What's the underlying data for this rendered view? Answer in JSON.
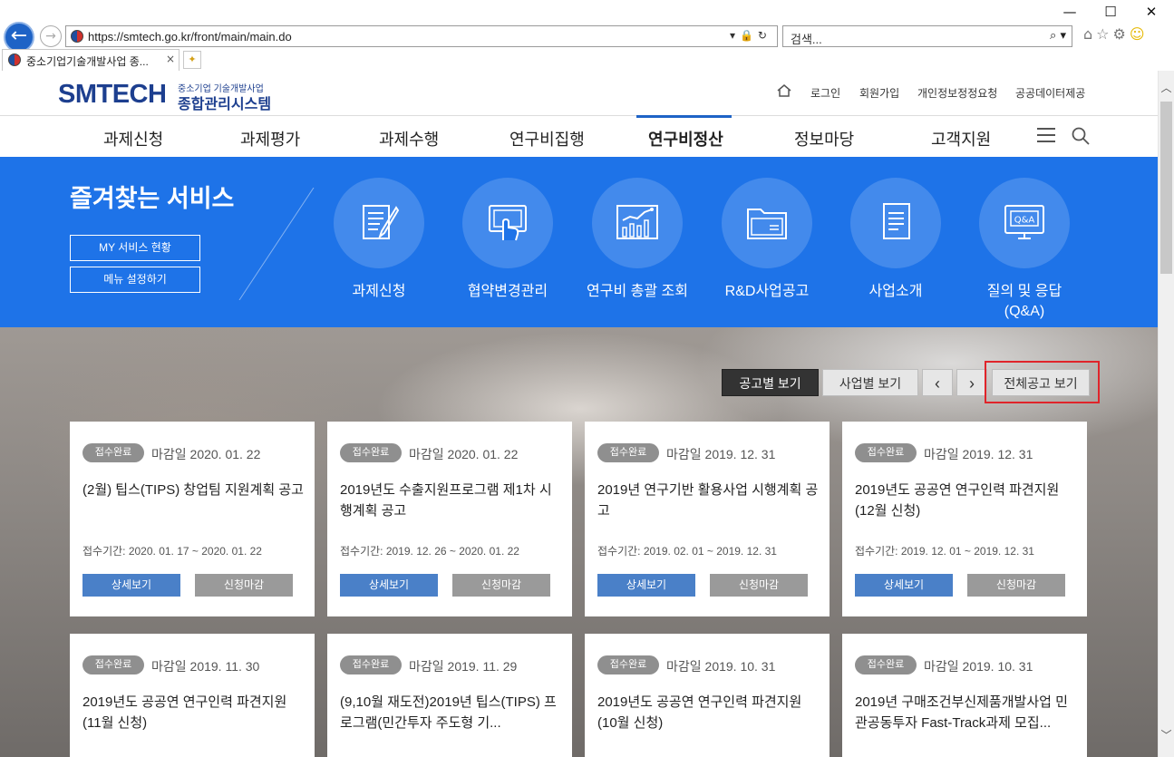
{
  "browser": {
    "url": "https://smtech.go.kr/front/main/main.do",
    "search_placeholder": "검색...",
    "tab_title": "중소기업기술개발사업 종...",
    "window_controls": [
      "—",
      "☐",
      "✕"
    ]
  },
  "header": {
    "logo_main": "SMTECH",
    "logo_sub1": "중소기업 기술개발사업",
    "logo_sub2": "종합관리시스템",
    "util_links": [
      "로그인",
      "회원가입",
      "개인정보정정요청",
      "공공데이터제공"
    ]
  },
  "gnb": {
    "items": [
      "과제신청",
      "과제평가",
      "과제수행",
      "연구비집행",
      "연구비정산",
      "정보마당",
      "고객지원"
    ],
    "active": "연구비정산"
  },
  "favorites": {
    "title": "즐겨찾는 서비스",
    "buttons": [
      "MY 서비스 현황",
      "메뉴 설정하기"
    ],
    "services": [
      {
        "label": "과제신청",
        "icon": "document-edit-icon"
      },
      {
        "label": "협약변경관리",
        "icon": "touch-screen-icon"
      },
      {
        "label": "연구비 총괄 조회",
        "icon": "bar-chart-icon"
      },
      {
        "label": "R&D사업공고",
        "icon": "folder-icon"
      },
      {
        "label": "사업소개",
        "icon": "document-icon"
      },
      {
        "label": "질의 및 응답\n(Q&A)",
        "icon": "qa-monitor-icon"
      }
    ]
  },
  "announcements": {
    "controls": {
      "by_notice": "공고별 보기",
      "by_business": "사업별 보기",
      "prev": "‹",
      "next": "›",
      "view_all": "전체공고 보기"
    },
    "cards": [
      {
        "status": "접수완료",
        "deadline": "마감일 2020. 01. 22",
        "title": "(2월) 팁스(TIPS) 창업팀 지원계획 공고",
        "period": "접수기간: 2020. 01. 17 ~ 2020. 01. 22",
        "detail": "상세보기",
        "closed": "신청마감"
      },
      {
        "status": "접수완료",
        "deadline": "마감일 2020. 01. 22",
        "title": "2019년도 수출지원프로그램 제1차 시행계획 공고",
        "period": "접수기간: 2019. 12. 26 ~ 2020. 01. 22",
        "detail": "상세보기",
        "closed": "신청마감"
      },
      {
        "status": "접수완료",
        "deadline": "마감일 2019. 12. 31",
        "title": "2019년 연구기반 활용사업 시행계획 공고",
        "period": "접수기간: 2019. 02. 01 ~ 2019. 12. 31",
        "detail": "상세보기",
        "closed": "신청마감"
      },
      {
        "status": "접수완료",
        "deadline": "마감일 2019. 12. 31",
        "title": "2019년도 공공연 연구인력 파견지원(12월 신청)",
        "period": "접수기간: 2019. 12. 01 ~ 2019. 12. 31",
        "detail": "상세보기",
        "closed": "신청마감"
      },
      {
        "status": "접수완료",
        "deadline": "마감일 2019. 11. 30",
        "title": "2019년도 공공연 연구인력 파견지원(11월 신청)"
      },
      {
        "status": "접수완료",
        "deadline": "마감일 2019. 11. 29",
        "title": "(9,10월 재도전)2019년 팁스(TIPS) 프로그램(민간투자 주도형 기..."
      },
      {
        "status": "접수완료",
        "deadline": "마감일 2019. 10. 31",
        "title": "2019년도 공공연 연구인력 파견지원(10월 신청)"
      },
      {
        "status": "접수완료",
        "deadline": "마감일 2019. 10. 31",
        "title": "2019년 구매조건부신제품개발사업 민관공동투자 Fast-Track과제 모집..."
      }
    ]
  }
}
